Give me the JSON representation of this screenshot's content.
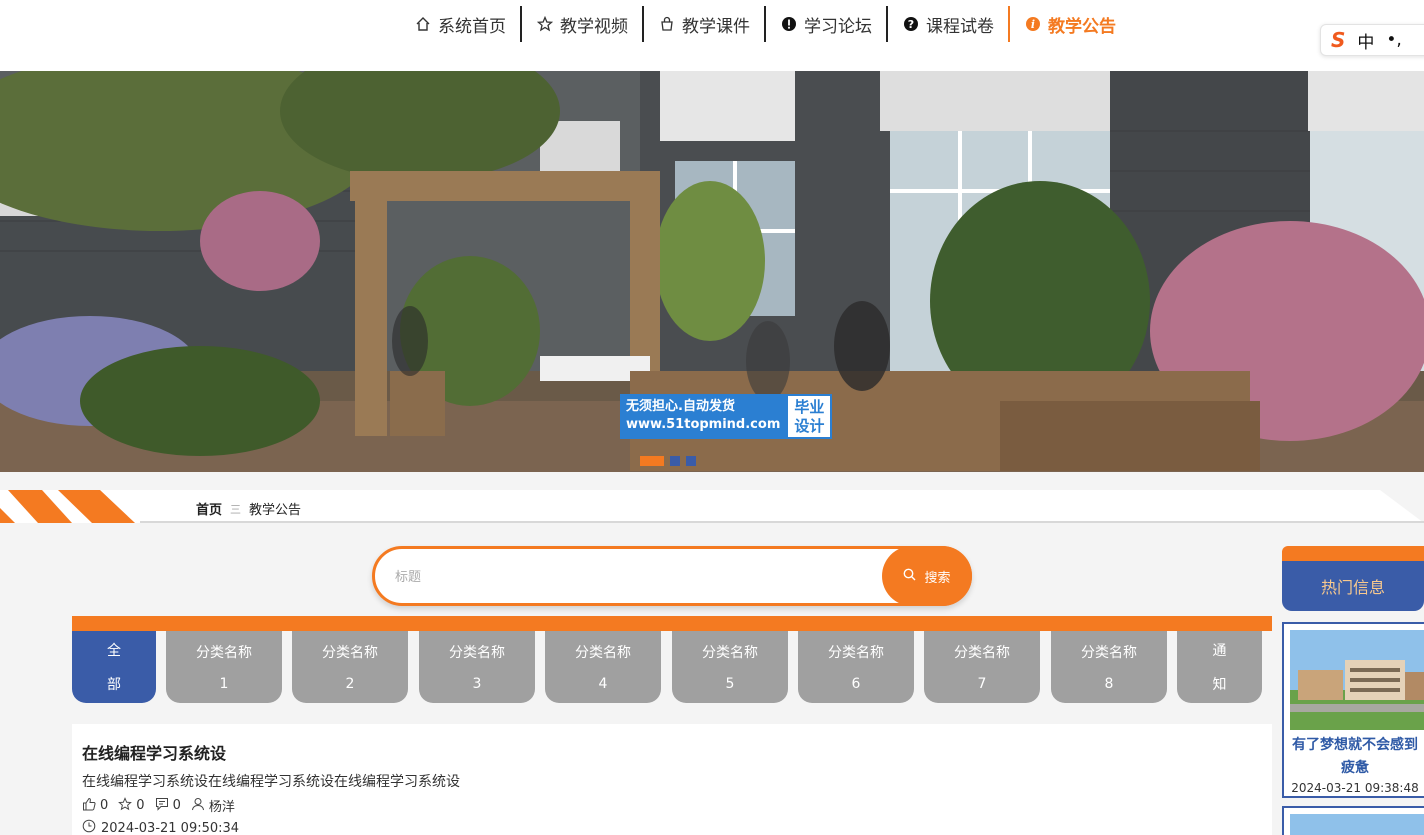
{
  "nav": {
    "items": [
      {
        "label": "系统首页",
        "icon": "home-icon"
      },
      {
        "label": "教学视频",
        "icon": "star-icon"
      },
      {
        "label": "教学课件",
        "icon": "bag-icon"
      },
      {
        "label": "学习论坛",
        "icon": "exclamation-icon"
      },
      {
        "label": "课程试卷",
        "icon": "question-icon"
      },
      {
        "label": "教学公告",
        "icon": "info-icon"
      }
    ],
    "active_index": 5
  },
  "ime": {
    "logo": "S",
    "mode": "中",
    "punct": "•,"
  },
  "banner": {
    "watermark_left_line1": "无须担心.自动发货",
    "watermark_left_line2": "www.51topmind.com",
    "watermark_right_line1": "毕业",
    "watermark_right_line2": "设计",
    "slide_count": 3,
    "active_slide": 0
  },
  "breadcrumb": {
    "home": "首页",
    "separator": "三",
    "current": "教学公告"
  },
  "search": {
    "placeholder": "标题",
    "button_label": "搜索"
  },
  "categories": [
    {
      "line1": "全",
      "line2": "部"
    },
    {
      "line1": "分类名称",
      "line2": "1"
    },
    {
      "line1": "分类名称",
      "line2": "2"
    },
    {
      "line1": "分类名称",
      "line2": "3"
    },
    {
      "line1": "分类名称",
      "line2": "4"
    },
    {
      "line1": "分类名称",
      "line2": "5"
    },
    {
      "line1": "分类名称",
      "line2": "6"
    },
    {
      "line1": "分类名称",
      "line2": "7"
    },
    {
      "line1": "分类名称",
      "line2": "8"
    },
    {
      "line1": "通",
      "line2": "知"
    }
  ],
  "active_category": 0,
  "article": {
    "title": "在线编程学习系统设",
    "desc": "在线编程学习系统设在线编程学习系统设在线编程学习系统设",
    "likes": "0",
    "favorites": "0",
    "comments": "0",
    "author": "杨洋",
    "date": "2024-03-21 09:50:34"
  },
  "hot": {
    "heading": "热门信息",
    "item_title": "有了梦想就不会感到疲惫",
    "item_date": "2024-03-21 09:38:48"
  },
  "colors": {
    "accent": "#f47a21",
    "brand_blue": "#3a5ca8",
    "category_grey": "#a0a0a0"
  }
}
